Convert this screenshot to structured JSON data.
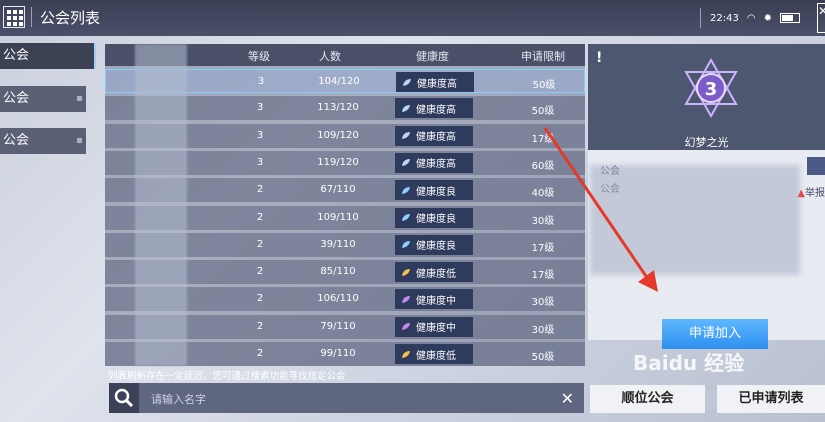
{
  "header": {
    "title": "公会列表",
    "time": "22:43"
  },
  "tabs": [
    {
      "label": "公会"
    },
    {
      "label": "公会"
    },
    {
      "label": "公会"
    }
  ],
  "table": {
    "columns": [
      "等级",
      "人数",
      "健康度",
      "申请限制"
    ],
    "rows": [
      {
        "level": "3",
        "members": "104/120",
        "health": "健康度高",
        "health_color": "#b9d6ff",
        "limit": "50级"
      },
      {
        "level": "3",
        "members": "113/120",
        "health": "健康度高",
        "health_color": "#b9d6ff",
        "limit": "50级"
      },
      {
        "level": "3",
        "members": "109/120",
        "health": "健康度高",
        "health_color": "#b9d6ff",
        "limit": "17级"
      },
      {
        "level": "3",
        "members": "119/120",
        "health": "健康度高",
        "health_color": "#b9d6ff",
        "limit": "60级"
      },
      {
        "level": "2",
        "members": "67/110",
        "health": "健康度良",
        "health_color": "#8fd0ff",
        "limit": "40级"
      },
      {
        "level": "2",
        "members": "109/110",
        "health": "健康度良",
        "health_color": "#8fd0ff",
        "limit": "30级"
      },
      {
        "level": "2",
        "members": "39/110",
        "health": "健康度良",
        "health_color": "#8fd0ff",
        "limit": "17级"
      },
      {
        "level": "2",
        "members": "85/110",
        "health": "健康度低",
        "health_color": "#f2c14e",
        "limit": "17级"
      },
      {
        "level": "2",
        "members": "106/110",
        "health": "健康度中",
        "health_color": "#c48af0",
        "limit": "30级"
      },
      {
        "level": "2",
        "members": "79/110",
        "health": "健康度中",
        "health_color": "#c48af0",
        "limit": "30级"
      },
      {
        "level": "2",
        "members": "99/110",
        "health": "健康度低",
        "health_color": "#f2c14e",
        "limit": "50级"
      }
    ]
  },
  "hint": "列表刷新存在一定延迟，您可通过搜索功能寻找指定公会",
  "search": {
    "placeholder": "请输入名字"
  },
  "panel": {
    "emblem_level": "3",
    "guild_name": "幻梦之光",
    "label1": "公会",
    "label2": "公会",
    "report": "举报",
    "apply": "申请加入"
  },
  "buttons": {
    "rank": "顺位公会",
    "applied": "已申请列表"
  },
  "watermark": "Baidu 经验"
}
